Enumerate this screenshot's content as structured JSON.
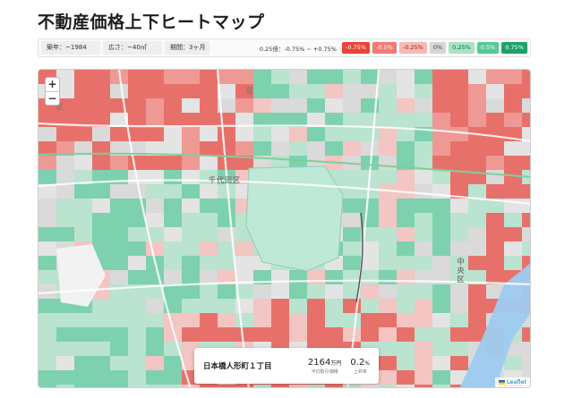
{
  "title": "不動産価格上下ヒートマップ",
  "filters": [
    {
      "id": "year",
      "label": "築年：~1984"
    },
    {
      "id": "area",
      "label": "広さ：~40㎡"
    },
    {
      "id": "period",
      "label": "期間：3ヶ月"
    }
  ],
  "legend": {
    "range_label": "0.25倍：-0.75% ~ +0.75%",
    "items": [
      {
        "label": "-0.75%",
        "bg": "#e8443a",
        "fg": "#ffffff"
      },
      {
        "label": "-0.5%",
        "bg": "#f17b74",
        "fg": "#ffffff"
      },
      {
        "label": "-0.25%",
        "bg": "#f8b9b5",
        "fg": "#8a2a25"
      },
      {
        "label": "0%",
        "bg": "#d6d6d6",
        "fg": "#444444"
      },
      {
        "label": "0.25%",
        "bg": "#a9e2c8",
        "fg": "#1d5e40"
      },
      {
        "label": "0.5%",
        "bg": "#55c99a",
        "fg": "#ffffff"
      },
      {
        "label": "0.75%",
        "bg": "#1ea06a",
        "fg": "#ffffff"
      }
    ]
  },
  "map": {
    "zoom_in": "+",
    "zoom_out": "−",
    "wards": {
      "chiyoda": "千代田区",
      "chuo": "中央区",
      "bunkyo": "区",
      "left": "区"
    },
    "attribution": "Leaflet"
  },
  "info": {
    "place": "日本橋人形町１丁目",
    "price": "2164",
    "price_unit": "万円",
    "price_caption": "平均取引価格",
    "change": "0.2",
    "change_unit": "%",
    "change_caption": "上昇率"
  }
}
